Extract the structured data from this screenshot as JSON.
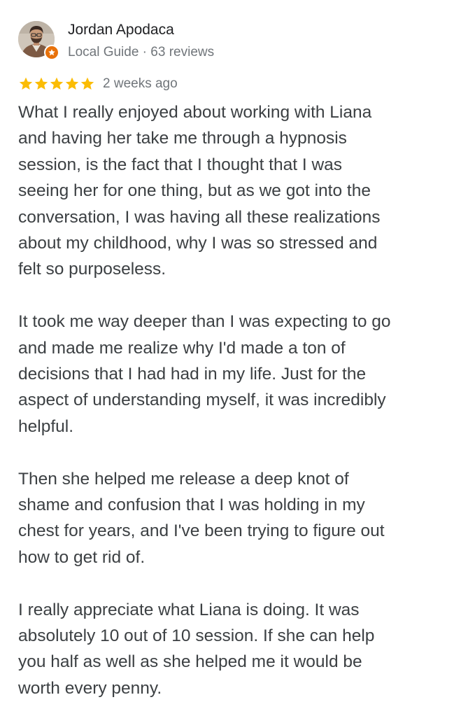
{
  "reviewer": {
    "name": "Jordan Apodaca",
    "meta": "Local Guide · 63 reviews",
    "badge_icon": "local-guide-star-icon",
    "badge_color": "#e8710a"
  },
  "rating": {
    "stars": 5,
    "max": 5,
    "star_color": "#fbbc04",
    "date": "2 weeks ago"
  },
  "review": {
    "paragraphs": [
      "What I really enjoyed about working with Liana\nand having her take me through a  hypnosis\nsession, is the fact that I thought that I was\nseeing her for one thing, but as we got into the\nconversation, I was having all these realizations\nabout my childhood, why I was so stressed and\nfelt so purposeless.",
      "It took me way deeper than I was expecting to go\nand made me realize why I'd made a ton of\ndecisions that I had had in my life. Just for the\naspect of understanding myself, it was incredibly\nhelpful.",
      "Then she helped me release a deep knot of\nshame and confusion that I was holding in my\nchest for years, and I've been trying to figure out\nhow to get rid of.",
      "I really appreciate what Liana is doing. It was\nabsolutely 10 out of 10 session. If she can help\nyou half as well as she helped me it would be\nworth every penny."
    ]
  }
}
